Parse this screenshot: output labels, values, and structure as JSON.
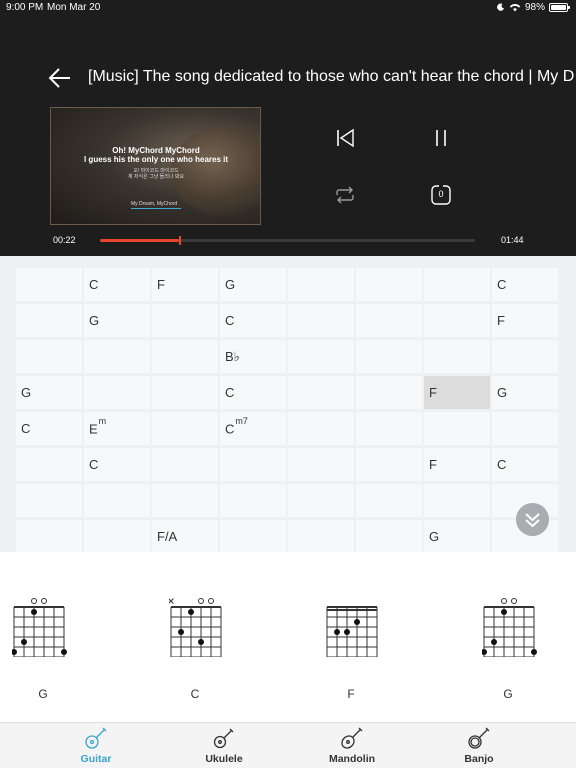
{
  "status": {
    "time": "9:00 PM",
    "date": "Mon Mar 20",
    "battery": "98%",
    "battery_level": 0.98
  },
  "player": {
    "title": "[Music] The song dedicated to those who can't hear the chord | My D",
    "video": {
      "line1": "Oh! MyChord MyChord",
      "line2": "I guess his the only one who heares it",
      "line3": "오! 마이코드 마이코드",
      "line4": "계 저식은 그냥 들리나 봐요",
      "line5": "My Dream, MyChord"
    },
    "repeat_count": "0",
    "current_time": "00:22",
    "total_time": "01:44",
    "progress": 0.21,
    "accent": "#e8452f"
  },
  "grid": [
    [
      "",
      "C",
      "F",
      "G",
      "",
      "",
      "",
      "C"
    ],
    [
      "",
      "G",
      "",
      "C",
      "",
      "",
      "",
      "F"
    ],
    [
      "",
      "",
      "",
      "B♭",
      "",
      "",
      "",
      ""
    ],
    [
      "G",
      "",
      "",
      "C",
      "",
      "",
      "F",
      "G"
    ],
    [
      "C",
      "Em",
      "",
      "Cm7",
      "",
      "",
      "",
      ""
    ],
    [
      "",
      "C",
      "",
      "",
      "",
      "",
      "F",
      "C"
    ],
    [
      "",
      "",
      "",
      "",
      "",
      "",
      "",
      ""
    ],
    [
      "",
      "",
      "F/A",
      "",
      "",
      "",
      "G",
      ""
    ]
  ],
  "active_cell": [
    3,
    6
  ],
  "diagrams": [
    {
      "name": "G",
      "shape": "G"
    },
    {
      "name": "C",
      "shape": "C"
    },
    {
      "name": "F",
      "shape": "F"
    },
    {
      "name": "G",
      "shape": "G"
    }
  ],
  "tabs": [
    {
      "label": "Guitar",
      "icon": "guitar-icon",
      "selected": true
    },
    {
      "label": "Ukulele",
      "icon": "ukulele-icon",
      "selected": false
    },
    {
      "label": "Mandolin",
      "icon": "mandolin-icon",
      "selected": false
    },
    {
      "label": "Banjo",
      "icon": "banjo-icon",
      "selected": false
    }
  ],
  "colors": {
    "tab_selected": "#3aa3cf",
    "top_bg": "#1d1d1d"
  }
}
